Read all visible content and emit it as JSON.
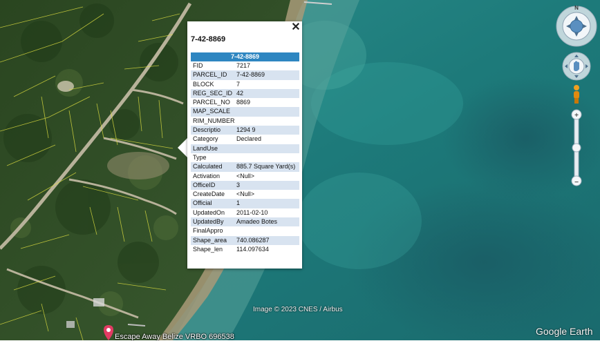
{
  "balloon": {
    "title": "7-42-8869",
    "close_label": "✕",
    "header": "7-42-8869",
    "rows": [
      {
        "key": "FID",
        "value": "7217"
      },
      {
        "key": "PARCEL_ID",
        "value": "7-42-8869"
      },
      {
        "key": "BLOCK",
        "value": "7"
      },
      {
        "key": "REG_SEC_ID",
        "value": "42"
      },
      {
        "key": "PARCEL_NO",
        "value": "8869"
      },
      {
        "key": "MAP_SCALE",
        "value": ""
      },
      {
        "key": "RIM_NUMBER",
        "value": ""
      },
      {
        "key": "Descriptio",
        "value": "1294 9"
      },
      {
        "key": "Category",
        "value": "Declared"
      },
      {
        "key": "LandUse",
        "value": ""
      },
      {
        "key": "Type",
        "value": ""
      },
      {
        "key": "Calculated",
        "value": "885.7 Square Yard(s)"
      },
      {
        "key": "Activation",
        "value": "<Null>"
      },
      {
        "key": "OfficeID",
        "value": "3"
      },
      {
        "key": "CreateDate",
        "value": "<Null>"
      },
      {
        "key": "Official",
        "value": "1"
      },
      {
        "key": "UpdatedOn",
        "value": "2011-02-10"
      },
      {
        "key": "UpdatedBy",
        "value": "Amadeo Botes"
      },
      {
        "key": "FinalAppro",
        "value": ""
      },
      {
        "key": "Shape_area",
        "value": "740.086287"
      },
      {
        "key": "Shape_len",
        "value": "114.097634"
      }
    ]
  },
  "map": {
    "copyright": "Image © 2023 CNES / Airbus",
    "brand": "Google Earth",
    "placemark_label": "Escape Away Belize VRBO 696538"
  },
  "nav": {
    "compass_north": "N",
    "zoom_in": "+",
    "zoom_out": "−"
  },
  "colors": {
    "header_blue": "#2e86c1",
    "row_alt": "#d8e3f0",
    "sea": "#1f7f80",
    "land": "#2f4a25"
  }
}
